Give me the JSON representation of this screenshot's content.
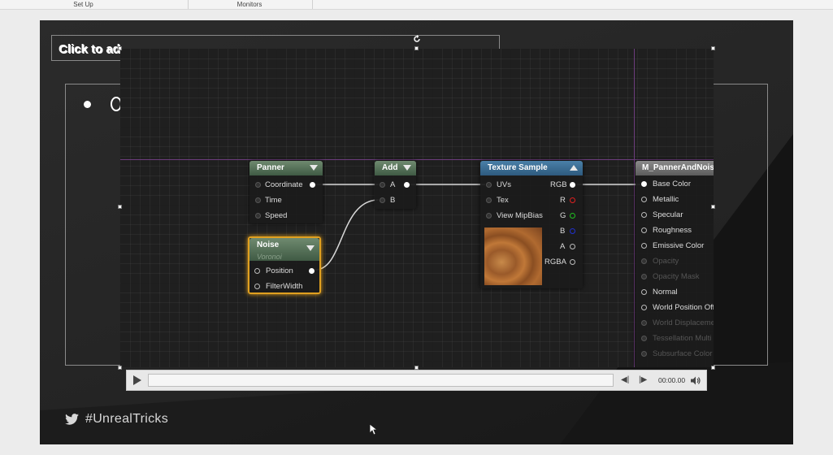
{
  "topbar": {
    "tabs": [
      "Set Up",
      "Monitors"
    ]
  },
  "slide": {
    "title_placeholder": "Click to ad",
    "title_suffix": "d title",
    "hashtag": "#UnrealTricks"
  },
  "nodes": {
    "panner": {
      "title": "Panner",
      "pins": [
        "Coordinate",
        "Time",
        "Speed"
      ]
    },
    "add": {
      "title": "Add",
      "pins": [
        "A",
        "B"
      ]
    },
    "noise": {
      "title": "Noise",
      "subtitle": "Voronoi",
      "pins": [
        "Position",
        "FilterWidth"
      ]
    },
    "texture_sample": {
      "title": "Texture Sample",
      "inputs": [
        "UVs",
        "Tex",
        "View MipBias"
      ],
      "outputs": [
        "RGB",
        "R",
        "G",
        "B",
        "A",
        "RGBA"
      ]
    },
    "material": {
      "title": "M_PannerAndNoise",
      "pins": [
        "Base Color",
        "Metallic",
        "Specular",
        "Roughness",
        "Emissive Color",
        "Opacity",
        "Opacity Mask",
        "Normal",
        "World Position Off",
        "World Displaceme",
        "Tessellation Multi",
        "Subsurface Color"
      ]
    }
  },
  "player": {
    "time": "00:00.00"
  },
  "colors": {
    "selection_accent": "#e0a020",
    "texture_header": "#3c6e96",
    "r_pin": "#e02020",
    "g_pin": "#20c020",
    "b_pin": "#2030d0"
  }
}
